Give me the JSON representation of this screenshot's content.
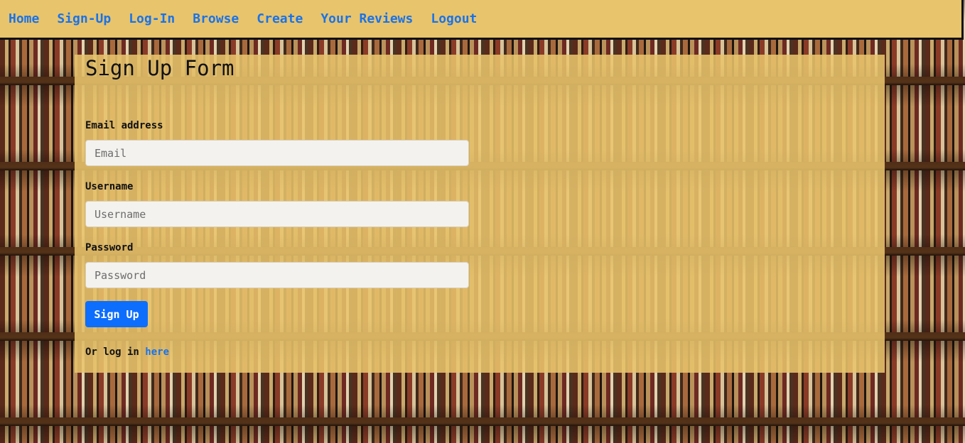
{
  "nav": {
    "items": [
      "Home",
      "Sign-Up",
      "Log-In",
      "Browse",
      "Create",
      "Your Reviews",
      "Logout"
    ]
  },
  "form": {
    "title": "Sign Up Form",
    "email_label": "Email address",
    "email_placeholder": "Email",
    "username_label": "Username",
    "username_placeholder": "Username",
    "password_label": "Password",
    "password_placeholder": "Password",
    "submit_label": "Sign Up",
    "login_prompt": "Or log in",
    "login_link": "here"
  },
  "colors": {
    "navbar_bg": "#e8c46c",
    "link": "#1a73e8",
    "button": "#0d6efd"
  }
}
